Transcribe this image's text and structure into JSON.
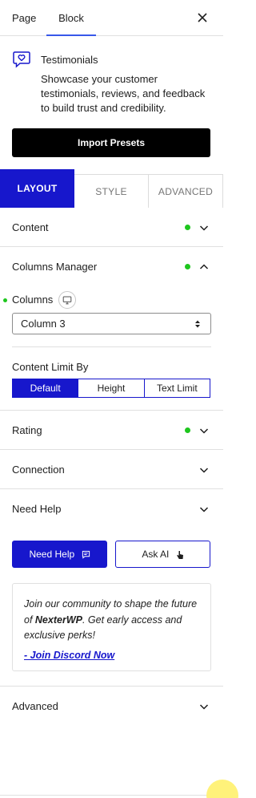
{
  "header": {
    "tabs": [
      {
        "label": "Page"
      },
      {
        "label": "Block"
      }
    ],
    "active_tab": "Block"
  },
  "block": {
    "icon": "heart-chat-icon",
    "title": "Testimonials",
    "description": "Showcase your customer testimonials, reviews, and feedback to build trust and credibility."
  },
  "import_button": "Import Presets",
  "settings_tabs": [
    {
      "label": "LAYOUT"
    },
    {
      "label": "STYLE"
    },
    {
      "label": "ADVANCED"
    }
  ],
  "panels": {
    "content": {
      "label": "Content",
      "modified": true
    },
    "columns_manager": {
      "label": "Columns Manager",
      "modified": true,
      "expanded": true,
      "columns_label": "Columns",
      "columns_value": "Column 3",
      "content_limit_label": "Content Limit By",
      "content_limit_options": [
        "Default",
        "Height",
        "Text Limit"
      ],
      "content_limit_selected": "Default"
    },
    "rating": {
      "label": "Rating",
      "modified": true
    },
    "connection": {
      "label": "Connection"
    },
    "need_help": {
      "label": "Need Help"
    },
    "advanced": {
      "label": "Advanced"
    }
  },
  "help": {
    "need_help_button": "Need Help",
    "ask_ai_button": "Ask AI",
    "community_text_1": "Join our community to shape the future of ",
    "community_brand": "NexterWP",
    "community_text_2": ". Get early access and exclusive perks!",
    "discord_link": "- Join Discord Now"
  },
  "colors": {
    "accent": "#1717cc",
    "modified_dot": "#1ec61e",
    "tab_underline": "#3858e9"
  }
}
